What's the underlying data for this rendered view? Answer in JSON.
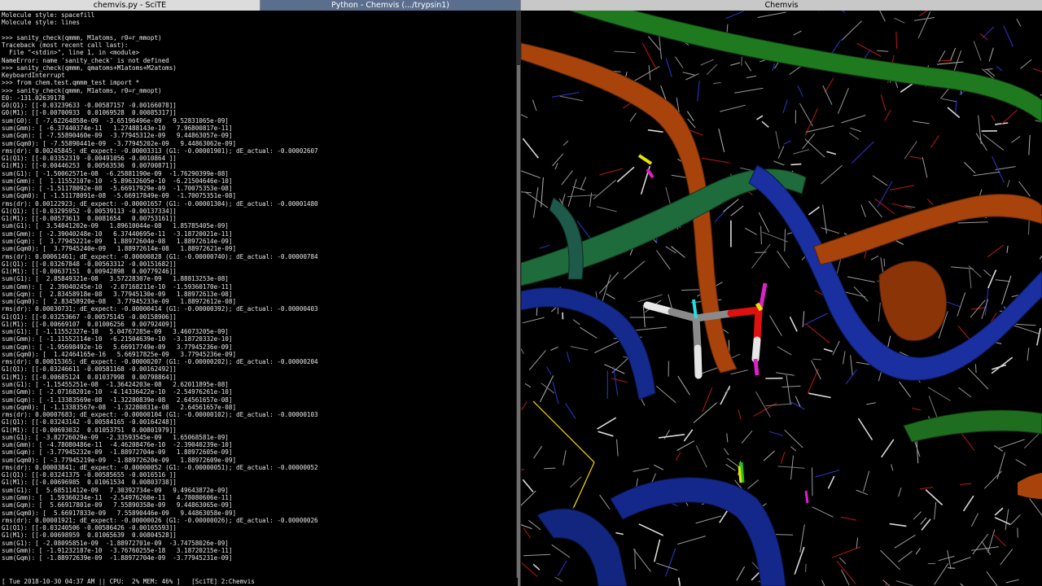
{
  "tabs": [
    {
      "label": "chemvis.py - SciTE"
    },
    {
      "label": "Python - Chemvis (.../trypsin1)"
    },
    {
      "label": "Chemvis"
    }
  ],
  "terminal": {
    "lines": [
      "Molecule style: spacefill",
      "Molecule style: lines",
      "",
      ">>> sanity_check(qmmm, M1atoms, r0=r_mmopt)",
      "Traceback (most recent call last):",
      "  File \"<stdin>\", line 1, in <module>",
      "NameError: name 'sanity_check' is not defined",
      ">>> sanity_check(qmmm, qmatoms+M1atoms+M2atoms)",
      "KeyboardInterrupt",
      ">>> from chem.test.qmmm_test import *",
      ">>> sanity_check(qmmm, M1atoms, r0=r_mmopt)",
      "E0: -131.02639178",
      "G0(Q1): [[-0.03239633 -0.00587157 -0.00166078]]",
      "G0(M1): [[-0.00700933  0.01069528  0.00085317]]",
      "sum(G0): [ -7.62264858e-09  -3.65196496e-09   9.52831065e-09]",
      "sum(Gmm): [ -6.37440374e-11   1.27488143e-10   7.96800817e-11]",
      "sum(Gqm): [ -7.55890460e-09  -3.77945312e-09   9.44863057e-09]",
      "sum(Gqm0): [ -7.55890441e-09  -3.77945202e-09   9.44863062e-09]",
      "rms(dr): 0.00245845; dE_expect: -0.00003313 (G1: -0.00001901); dE_actual: -0.00002607",
      "G1(Q1): [[-0.03352319 -0.00491056 -0.0010864 ]]",
      "G1(M1): [[-0.00446253  0.00563536  0.00700871]]",
      "sum(G1): [ -1.50062571e-08  -6.25881190e-09  -1.76290399e-08]",
      "sum(Gmm): [  1.11552107e-10  -5.89632605e-10  -6.21504646e-10]",
      "sum(Gqm): [ -1.51178092e-08  -5.66917929e-09  -1.70075353e-08]",
      "sum(Gqm0): [ -1.51178091e-08  -5.66917849e-09  -1.70075351e-08]",
      "rms(dr): 0.00122923; dE_expect: -0.00001657 (G1: -0.00001304); dE_actual: -0.00001480",
      "G1(Q1): [[-0.03295952 -0.00539113 -0.00137334]]",
      "G1(M1): [[-0.00573613  0.0081654   0.00753161]]",
      "sum(G1): [  3.54041202e-09   1.89610044e-08   1.85785405e-09]",
      "sum(Gmm): [ -2.39040248e-10   6.37440695e-11  -3.18720021e-11]",
      "sum(Gqm): [  3.77945221e-09   1.88972604e-08   1.88972614e-09]",
      "sum(Gqm0): [  3.77945240e-09   1.88972614e-08   1.88972621e-09]",
      "rms(dr): 0.00061461; dE_expect: -0.00000828 (G1: -0.00000740); dE_actual: -0.00000784",
      "G1(Q1): [[-0.03267848 -0.00563312 -0.00151682]]",
      "G1(M1): [[-0.00637151  0.00942898  0.00779246]]",
      "sum(G1): [  2.85849321e-08   3.57228307e-09   1.88813253e-08]",
      "sum(Gmm): [  2.39040245e-10  -2.07168211e-10  -1.59360170e-11]",
      "sum(Gqm): [  2.83458918e-08   3.77945130e-09   1.88972613e-08]",
      "sum(Gqm0): [  2.83458920e-08   3.77945233e-09   1.88972612e-08]",
      "rms(dr): 0.00030731; dE_expect: -0.00000414 (G1: -0.00000392); dE_actual: -0.00000403",
      "G1(Q1): [[-0.03253667 -0.00575145 -0.00158906]]",
      "G1(M1): [[-0.00669107  0.01006256  0.00792409]]",
      "sum(G1): [ -1.11552327e-10   5.04767285e-09   3.46073205e-09]",
      "sum(Gmm): [ -1.11552114e-10  -6.21504639e-10  -3.18720332e-10]",
      "sum(Gqm): [ -1.95698492e-16   5.66917749e-09   3.77945236e-09]",
      "sum(Gqm0): [  1.42464165e-16   5.66917825e-09   3.77945236e-09]",
      "rms(dr): 0.00015365; dE_expect: -0.00000207 (G1: -0.00000202); dE_actual: -0.00000204",
      "G1(Q1): [[-0.03246611 -0.00581168 -0.00162492]]",
      "G1(M1): [[-0.00685124  0.01037998  0.00798864]]",
      "sum(G1): [ -1.15455251e-08  -1.36424203e-08   2.62011895e-08]",
      "sum(Gmm): [ -2.07168201e-10  -4.14336422e-10  -2.54976261e-10]",
      "sum(Gqm): [ -1.13383569e-08  -1.32280839e-08   2.64561657e-08]",
      "sum(Gqm0): [ -1.13383567e-08  -1.32280831e-08   2.64561657e-08]",
      "rms(dr): 0.00007683; dE_expect: -0.00000104 (G1: -0.00000102); dE_actual: -0.00000103",
      "G1(Q1): [[-0.03243142 -0.00584165 -0.00164248]]",
      "G1(M1): [[-0.00693032  0.01053751  0.00801979]]",
      "sum(G1): [ -3.82726029e-09  -2.33593545e-09   1.65068581e-09]",
      "sum(Gmm): [ -4.78080486e-11  -4.46208476e-10  -2.39040239e-10]",
      "sum(Gqm): [ -3.77945232e-09  -1.88972704e-09   1.88972605e-09]",
      "sum(Gqm0): [ -3.77945219e-09  -1.88972620e-09   1.88972609e-09]",
      "rms(dr): 0.00003841; dE_expect: -0.00000052 (G1: -0.00000051); dE_actual: -0.00000052",
      "G1(Q1): [[-0.03241375 -0.00585655 -0.0016516 ]]",
      "G1(M1): [[-0.00696985  0.01061534  0.00803738]]",
      "sum(G1): [  5.68511412e-09   7.30392734e-09   9.49643872e-09]",
      "sum(Gmm): [  1.59360234e-11  -2.54976260e-11   4.78080606e-11]",
      "sum(Gqm): [  5.66917801e-09   7.55890358e-09   9.44863065e-09]",
      "sum(Gqm0): [  5.66917833e-09   7.55890446e-09   9.44863058e-09]",
      "rms(dr): 0.00001921; dE_expect: -0.00000026 (G1: -0.00000026); dE_actual: -0.00000026",
      "G1(Q1): [[-0.03240506 -0.00586426 -0.00165593]]",
      "G1(M1): [[-0.00698959  0.01065639  0.00804528]]",
      "sum(G1): [ -2.08095851e-09  -1.88972701e-09  -3.74758026e-09]",
      "sum(Gmm): [ -1.91232187e-10  -3.76760255e-18   3.18720215e-11]",
      "sum(Gqm): [ -1.88972639e-09  -1.88972704e-09  -3.77945231e-09]"
    ]
  },
  "statusbar": {
    "text": "[ Tue 2018-10-30 04:37 AM || CPU:  2% MEM: 46% ]   [SciTE] 2:Chemvis"
  },
  "viewer": {
    "background": "#000000",
    "ribbon_colors": {
      "green": "#1e6e1e",
      "orange": "#a8430c",
      "blue": "#14288c",
      "teal": "#1e5a5a"
    },
    "atom_colors": {
      "carbon": "#808080",
      "oxygen": "#e01010",
      "hydrogen": "#e6e6e6",
      "nitrogen": "#2040ff",
      "sulfur": "#e6e600",
      "highlight_magenta": "#e020c8"
    }
  }
}
